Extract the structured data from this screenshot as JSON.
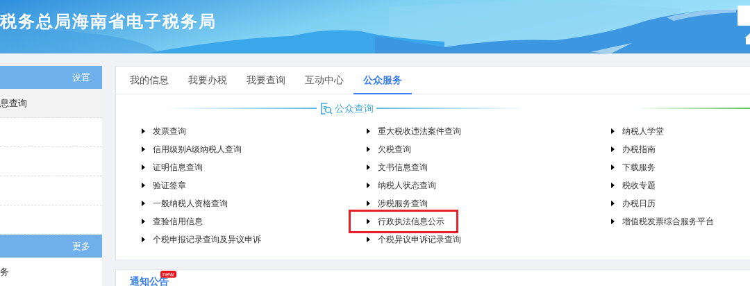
{
  "header": {
    "title": "税务总局海南省电子税务局"
  },
  "sidebar": [
    {
      "action": "设置",
      "items": [
        {
          "label": "息查询",
          "selected": true
        }
      ]
    },
    {
      "action": "更多",
      "items": [
        {
          "label": "务",
          "selected": false
        }
      ]
    }
  ],
  "tabs": [
    {
      "label": "我的信息",
      "selected": false
    },
    {
      "label": "我要办税",
      "selected": false
    },
    {
      "label": "我要查询",
      "selected": false
    },
    {
      "label": "互动中心",
      "selected": false
    },
    {
      "label": "公众服务",
      "selected": true
    }
  ],
  "section": {
    "title": "公众查询"
  },
  "columns": [
    [
      {
        "label": "发票查询",
        "highlighted": false
      },
      {
        "label": "信用级别A级纳税人查询",
        "highlighted": false
      },
      {
        "label": "证明信息查询",
        "highlighted": false
      },
      {
        "label": "验证签章",
        "highlighted": false
      },
      {
        "label": "一般纳税人资格查询",
        "highlighted": false
      },
      {
        "label": "查验信用信息",
        "highlighted": false
      },
      {
        "label": "个税申报记录查询及异议申诉",
        "highlighted": false
      }
    ],
    [
      {
        "label": "重大税收违法案件查询",
        "highlighted": false
      },
      {
        "label": "欠税查询",
        "highlighted": false
      },
      {
        "label": "文书信息查询",
        "highlighted": false
      },
      {
        "label": "纳税人状态查询",
        "highlighted": false
      },
      {
        "label": "涉税服务查询",
        "highlighted": false
      },
      {
        "label": "行政执法信息公示",
        "highlighted": true
      },
      {
        "label": "个税异议申诉记录查询",
        "highlighted": false
      }
    ],
    [
      {
        "label": "纳税人学堂",
        "highlighted": false
      },
      {
        "label": "办税指南",
        "highlighted": false
      },
      {
        "label": "下载服务",
        "highlighted": false
      },
      {
        "label": "税收专题",
        "highlighted": false
      },
      {
        "label": "办税日历",
        "highlighted": false
      },
      {
        "label": "增值税发票综合服务平台",
        "highlighted": false
      }
    ]
  ],
  "notice": {
    "title": "通知公告",
    "badge": "new"
  }
}
